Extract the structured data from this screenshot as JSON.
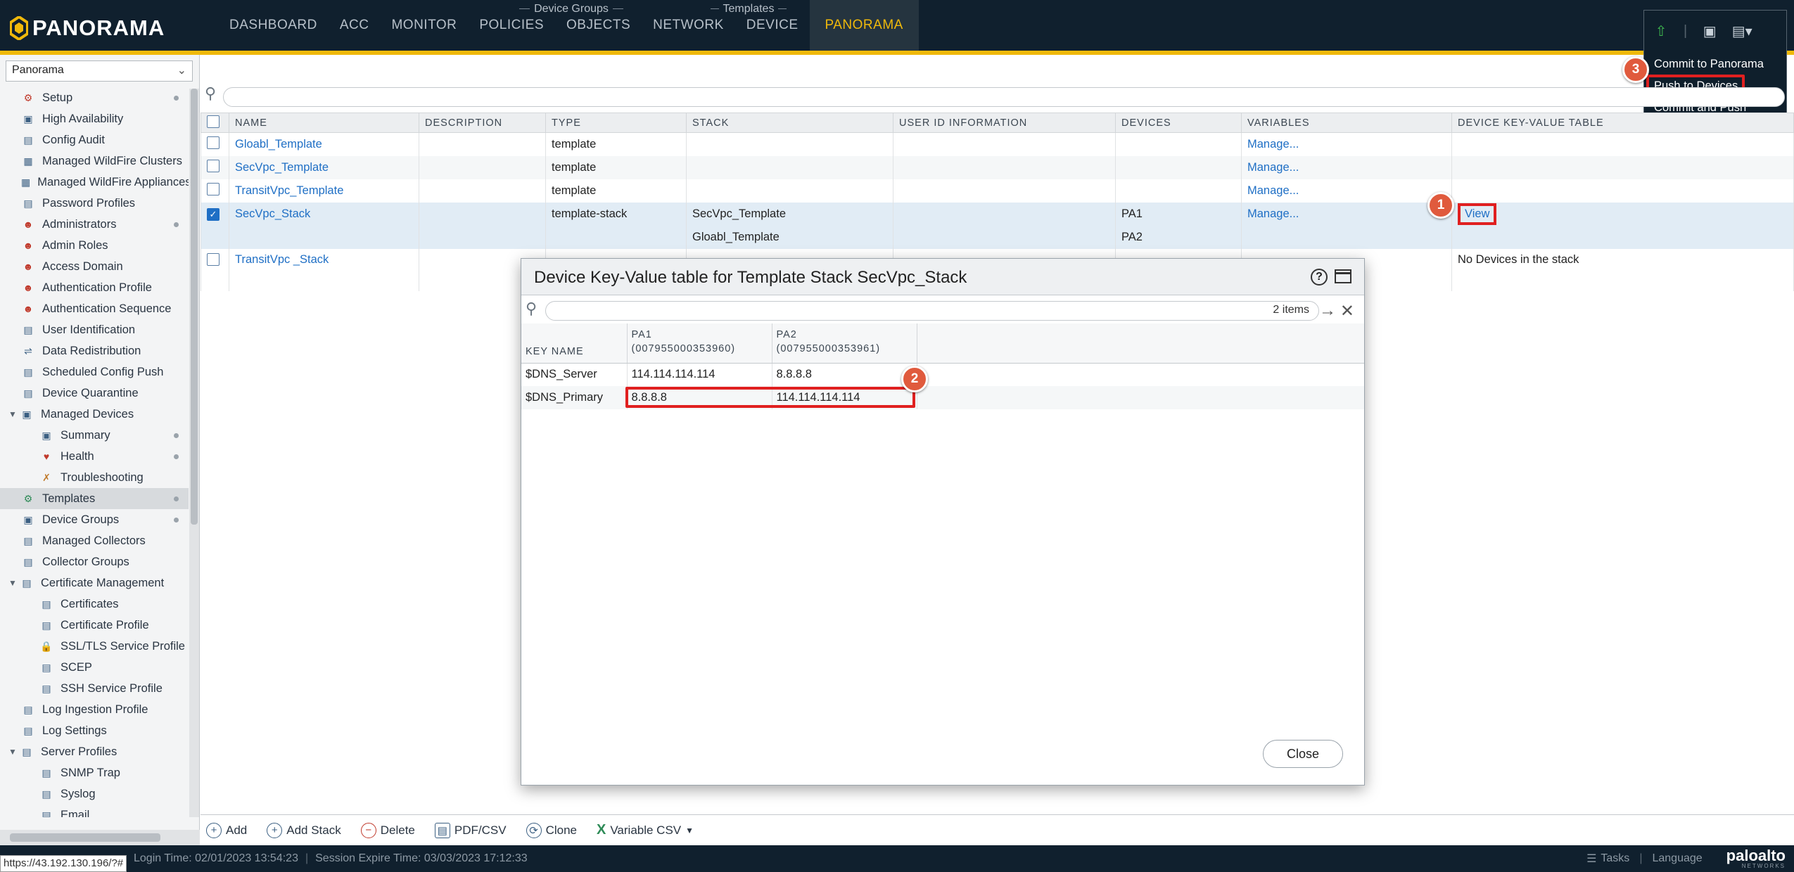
{
  "brand": "PANORAMA",
  "nav": {
    "items": [
      "DASHBOARD",
      "ACC",
      "MONITOR",
      "POLICIES",
      "OBJECTS",
      "NETWORK",
      "DEVICE",
      "PANORAMA"
    ],
    "group_device_groups": "Device Groups",
    "group_templates": "Templates"
  },
  "commit_menu": {
    "items": [
      "Commit to Panorama",
      "Push to Devices",
      "Commit and Push"
    ]
  },
  "callouts": [
    "1",
    "2",
    "3"
  ],
  "context_select": "Panorama",
  "sidebar": {
    "items": [
      {
        "label": "Setup",
        "icon": "setup-icon",
        "indent": 1,
        "dot": true
      },
      {
        "label": "High Availability",
        "icon": "ha-icon",
        "indent": 1
      },
      {
        "label": "Config Audit",
        "icon": "audit-icon",
        "indent": 1
      },
      {
        "label": "Managed WildFire Clusters",
        "icon": "cluster-icon",
        "indent": 1
      },
      {
        "label": "Managed WildFire Appliances",
        "icon": "appliance-icon",
        "indent": 1
      },
      {
        "label": "Password Profiles",
        "icon": "password-icon",
        "indent": 1
      },
      {
        "label": "Administrators",
        "icon": "admin-icon",
        "indent": 1,
        "dot": true
      },
      {
        "label": "Admin Roles",
        "icon": "roles-icon",
        "indent": 1
      },
      {
        "label": "Access Domain",
        "icon": "domain-icon",
        "indent": 1
      },
      {
        "label": "Authentication Profile",
        "icon": "auth-icon",
        "indent": 1
      },
      {
        "label": "Authentication Sequence",
        "icon": "auth-seq-icon",
        "indent": 1
      },
      {
        "label": "User Identification",
        "icon": "user-id-icon",
        "indent": 1
      },
      {
        "label": "Data Redistribution",
        "icon": "redistribution-icon",
        "indent": 1
      },
      {
        "label": "Scheduled Config Push",
        "icon": "schedule-icon",
        "indent": 1
      },
      {
        "label": "Device Quarantine",
        "icon": "quarantine-icon",
        "indent": 1
      },
      {
        "label": "Managed Devices",
        "icon": "devices-icon",
        "indent": 0,
        "expand": true
      },
      {
        "label": "Summary",
        "icon": "summary-icon",
        "indent": 2,
        "dot": true
      },
      {
        "label": "Health",
        "icon": "health-icon",
        "indent": 2,
        "dot": true
      },
      {
        "label": "Troubleshooting",
        "icon": "troubleshooting-icon",
        "indent": 2
      },
      {
        "label": "Templates",
        "icon": "templates-icon",
        "indent": 1,
        "dot": true,
        "active": true
      },
      {
        "label": "Device Groups",
        "icon": "device-groups-icon",
        "indent": 1,
        "dot": true
      },
      {
        "label": "Managed Collectors",
        "icon": "collectors-icon",
        "indent": 1
      },
      {
        "label": "Collector Groups",
        "icon": "collector-groups-icon",
        "indent": 1
      },
      {
        "label": "Certificate Management",
        "icon": "cert-mgmt-icon",
        "indent": 0,
        "expand": true
      },
      {
        "label": "Certificates",
        "icon": "certificate-icon",
        "indent": 2
      },
      {
        "label": "Certificate Profile",
        "icon": "cert-profile-icon",
        "indent": 2
      },
      {
        "label": "SSL/TLS Service Profile",
        "icon": "lock-icon",
        "indent": 2
      },
      {
        "label": "SCEP",
        "icon": "scep-icon",
        "indent": 2
      },
      {
        "label": "SSH Service Profile",
        "icon": "ssh-icon",
        "indent": 2
      },
      {
        "label": "Log Ingestion Profile",
        "icon": "log-ingest-icon",
        "indent": 1
      },
      {
        "label": "Log Settings",
        "icon": "log-settings-icon",
        "indent": 1
      },
      {
        "label": "Server Profiles",
        "icon": "server-profiles-icon",
        "indent": 0,
        "expand": true
      },
      {
        "label": "SNMP Trap",
        "icon": "snmp-icon",
        "indent": 2
      },
      {
        "label": "Syslog",
        "icon": "syslog-icon",
        "indent": 2
      },
      {
        "label": "Email",
        "icon": "email-icon",
        "indent": 2
      }
    ]
  },
  "table": {
    "headers": [
      "NAME",
      "DESCRIPTION",
      "TYPE",
      "STACK",
      "USER ID INFORMATION",
      "DEVICES",
      "VARIABLES",
      "DEVICE KEY-VALUE TABLE"
    ],
    "rows": [
      {
        "name": "Gloabl_Template",
        "description": "",
        "type": "template",
        "stack": "",
        "userid": "",
        "devices": "",
        "variables": "Manage...",
        "kv": "",
        "checked": false
      },
      {
        "name": "SecVpc_Template",
        "description": "",
        "type": "template",
        "stack": "",
        "userid": "",
        "devices": "",
        "variables": "Manage...",
        "kv": "",
        "checked": false
      },
      {
        "name": "TransitVpc_Template",
        "description": "",
        "type": "template",
        "stack": "",
        "userid": "",
        "devices": "",
        "variables": "Manage...",
        "kv": "",
        "checked": false
      },
      {
        "name": "SecVpc_Stack",
        "description": "",
        "type": "template-stack",
        "stack": "SecVpc_Template",
        "stack2": "Gloabl_Template",
        "userid": "",
        "devices": "PA1",
        "devices2": "PA2",
        "variables": "Manage...",
        "kv": "View",
        "checked": true
      },
      {
        "name": "TransitVpc _Stack",
        "description": "",
        "type": "",
        "stack": "",
        "userid": "",
        "devices": "",
        "variables": "",
        "kv": "No Devices in the stack",
        "checked": false
      }
    ]
  },
  "toolbar": {
    "add": "Add",
    "add_stack": "Add Stack",
    "delete": "Delete",
    "pdf_csv": "PDF/CSV",
    "clone": "Clone",
    "variable_csv": "Variable CSV"
  },
  "status": {
    "url": "https://43.192.130.196/?#",
    "login": "Login Time: 02/01/2023 13:54:23",
    "session": "Session Expire Time: 03/03/2023 17:12:33",
    "tasks": "Tasks",
    "language": "Language",
    "vendor": "paloalto",
    "vendor_sub": "NETWORKS"
  },
  "modal": {
    "title": "Device Key-Value table for Template Stack SecVpc_Stack",
    "count": "2 items",
    "col_key": "KEY NAME",
    "col_pa1_name": "PA1",
    "col_pa1_serial": "(007955000353960)",
    "col_pa2_name": "PA2",
    "col_pa2_serial": "(007955000353961)",
    "rows": [
      {
        "key": "$DNS_Server",
        "pa1": "114.114.114.114",
        "pa2": "8.8.8.8"
      },
      {
        "key": "$DNS_Primary",
        "pa1": "8.8.8.8",
        "pa2": "114.114.114.114"
      }
    ],
    "close": "Close"
  },
  "colors": {
    "accent": "#f0b90b",
    "nav_bg": "#10202e",
    "link": "#1f6fc5",
    "highlight": "#e02020",
    "callout": "#e05a3d"
  }
}
